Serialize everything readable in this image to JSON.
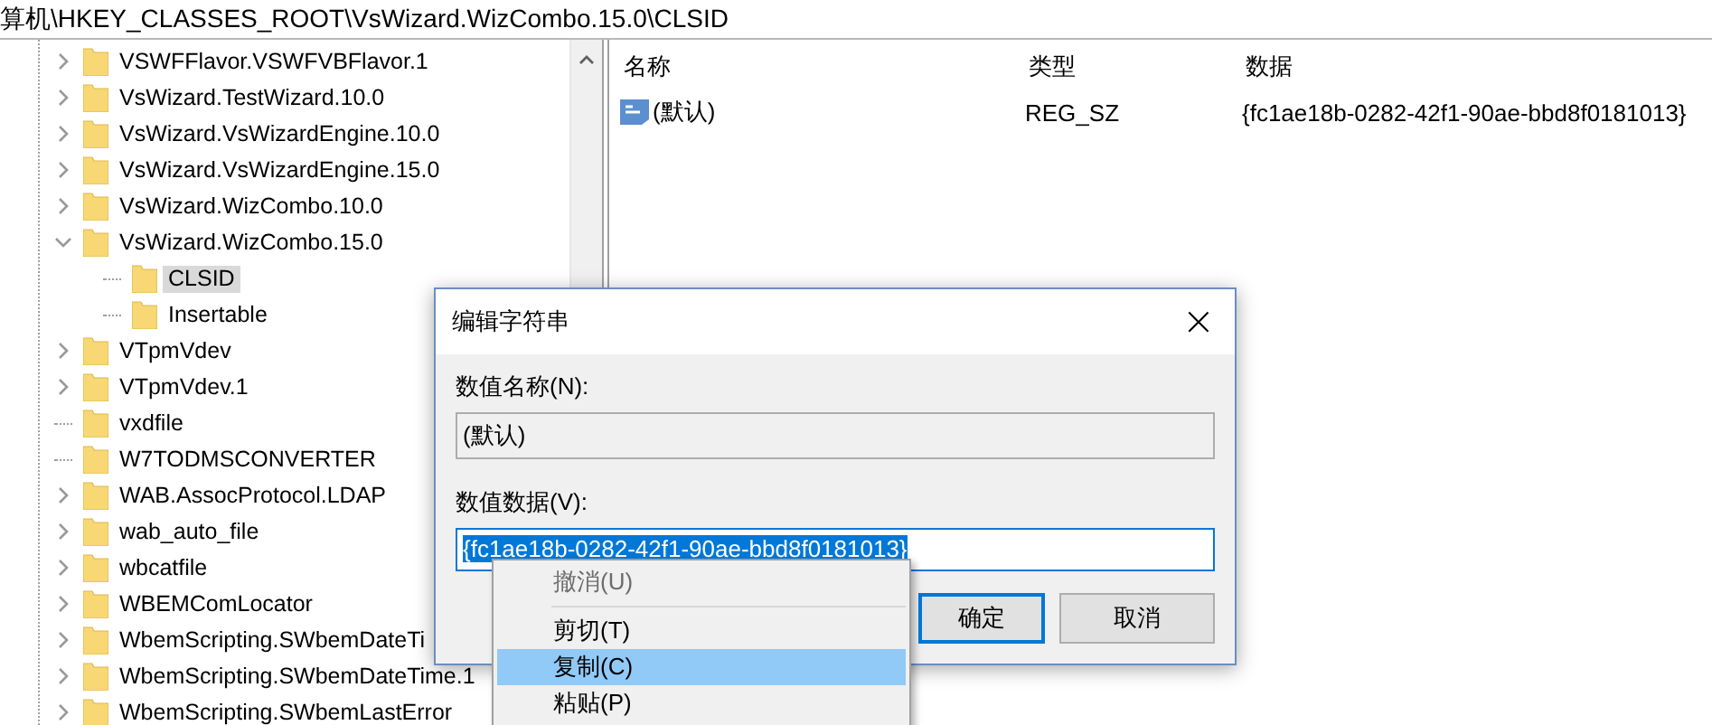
{
  "address_bar": {
    "path": "算机\\HKEY_CLASSES_ROOT\\VsWizard.WizCombo.15.0\\CLSID"
  },
  "tree": [
    {
      "label": "VSWFFlavor.VSWFVBFlavor.1",
      "kind": "node",
      "expanded": false,
      "selected": false
    },
    {
      "label": "VsWizard.TestWizard.10.0",
      "kind": "node",
      "expanded": false,
      "selected": false
    },
    {
      "label": "VsWizard.VsWizardEngine.10.0",
      "kind": "node",
      "expanded": false,
      "selected": false
    },
    {
      "label": "VsWizard.VsWizardEngine.15.0",
      "kind": "node",
      "expanded": false,
      "selected": false
    },
    {
      "label": "VsWizard.WizCombo.10.0",
      "kind": "node",
      "expanded": false,
      "selected": false
    },
    {
      "label": "VsWizard.WizCombo.15.0",
      "kind": "node",
      "expanded": true,
      "selected": false,
      "children": [
        {
          "label": "CLSID",
          "kind": "leaf",
          "selected": true
        },
        {
          "label": "Insertable",
          "kind": "leaf",
          "selected": false
        }
      ]
    },
    {
      "label": "VTpmVdev",
      "kind": "node",
      "expanded": false,
      "selected": false
    },
    {
      "label": "VTpmVdev.1",
      "kind": "node",
      "expanded": false,
      "selected": false
    },
    {
      "label": "vxdfile",
      "kind": "leaf",
      "selected": false
    },
    {
      "label": "W7TODMSCONVERTER",
      "kind": "leaf",
      "selected": false
    },
    {
      "label": "WAB.AssocProtocol.LDAP",
      "kind": "node",
      "expanded": false,
      "selected": false
    },
    {
      "label": "wab_auto_file",
      "kind": "node",
      "expanded": false,
      "selected": false
    },
    {
      "label": "wbcatfile",
      "kind": "node",
      "expanded": false,
      "selected": false
    },
    {
      "label": "WBEMComLocator",
      "kind": "node",
      "expanded": false,
      "selected": false
    },
    {
      "label": "WbemScripting.SWbemDateTi",
      "kind": "node",
      "expanded": false,
      "selected": false
    },
    {
      "label": "WbemScripting.SWbemDateTime.1",
      "kind": "node",
      "expanded": false,
      "selected": false
    },
    {
      "label": "WbemScripting.SWbemLastError",
      "kind": "node",
      "expanded": false,
      "selected": false
    }
  ],
  "values_table": {
    "columns": [
      "名称",
      "类型",
      "数据"
    ],
    "rows": [
      {
        "name": "(默认)",
        "type": "REG_SZ",
        "data": "{fc1ae18b-0282-42f1-90ae-bbd8f0181013}"
      }
    ]
  },
  "dialog": {
    "title": "编辑字符串",
    "close": "×",
    "name_label": "数值名称(N):",
    "name_value": "(默认)",
    "data_label": "数值数据(V):",
    "data_value": "{fc1ae18b-0282-42f1-90ae-bbd8f0181013}",
    "ok": "确定",
    "cancel": "取消"
  },
  "context_menu": [
    {
      "label": "撤消(U)",
      "kind": "item",
      "disabled": true,
      "selected": false
    },
    {
      "kind": "separator"
    },
    {
      "label": "剪切(T)",
      "kind": "item",
      "disabled": false,
      "selected": false
    },
    {
      "label": "复制(C)",
      "kind": "item",
      "disabled": false,
      "selected": true
    },
    {
      "label": "粘贴(P)",
      "kind": "item",
      "disabled": false,
      "selected": false
    }
  ]
}
